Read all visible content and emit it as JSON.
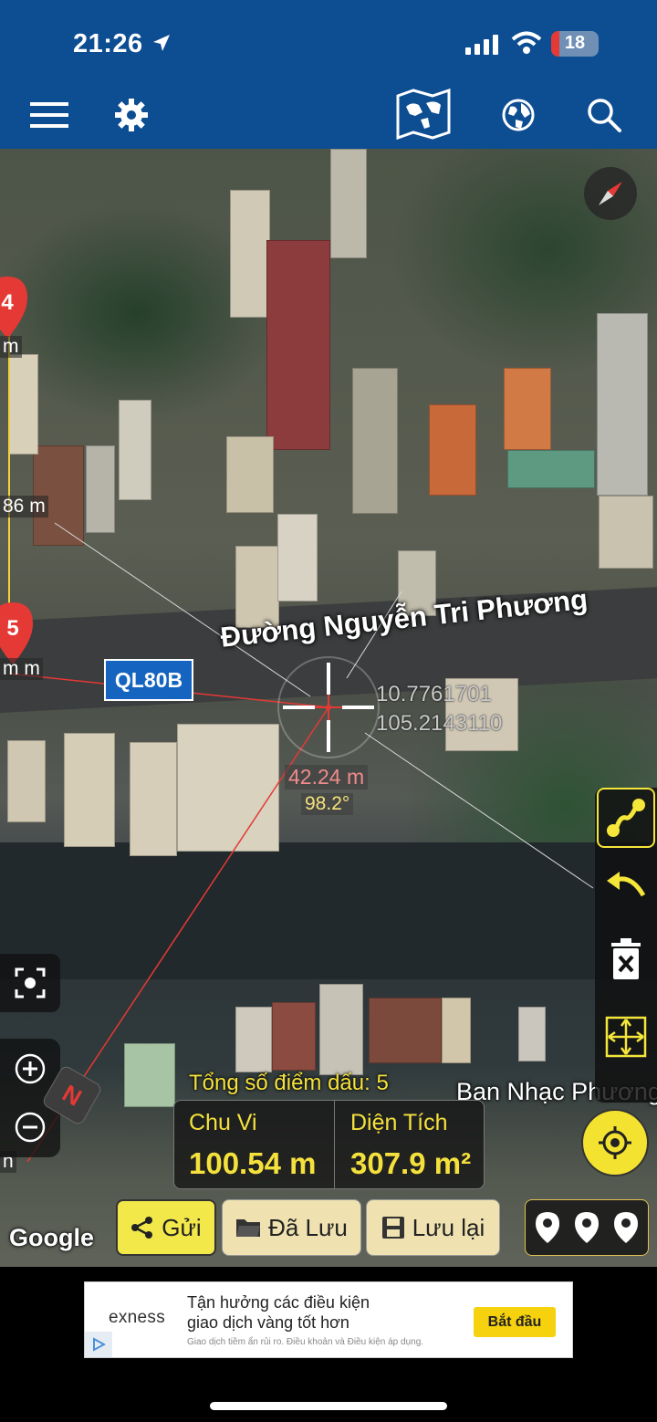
{
  "status_bar": {
    "time": "21:26",
    "battery": "18",
    "battery_level": 0.18
  },
  "top_bar": {
    "icons": [
      "menu-icon",
      "settings-icon",
      "map-type-icon",
      "globe-icon",
      "search-icon"
    ]
  },
  "map": {
    "street_name": "Đường Nguyễn Tri Phương",
    "route_shield": "QL80B",
    "coordinates": {
      "latitude": "10.7761701",
      "longitude": "105.2143110"
    },
    "measurement": {
      "distance": "42.24 m",
      "bearing": "98.2°"
    },
    "markers": [
      {
        "label": "4"
      },
      {
        "label": "5"
      }
    ],
    "edge_labels": [
      "m",
      "86 m",
      "m m",
      "n"
    ],
    "poi_label": "Ban Nhạc Phương",
    "attribution": "Google",
    "colors": {
      "marker": "#e53935",
      "measure_line": "#e53935",
      "accent_yellow": "#f5e13c"
    }
  },
  "controls": {
    "compass_icon": "compass-icon",
    "right_tools": [
      "route-icon",
      "undo-icon",
      "delete-icon",
      "fit-extent-icon"
    ],
    "left_tools": [
      "focus-icon",
      "zoom-in-icon",
      "zoom-out-icon"
    ],
    "north_label": "N",
    "locate_icon": "crosshair-gps-icon"
  },
  "summary": {
    "marker_count_label": "Tổng số điểm dấu: 5",
    "perimeter_label": "Chu Vi",
    "perimeter_value": "100.54 m",
    "area_label": "Diện Tích",
    "area_value": "307.9 m²"
  },
  "actions": {
    "send": "Gửi",
    "saved": "Đã Lưu",
    "save": "Lưu lại"
  },
  "ad": {
    "brand": "exness",
    "line1": "Tận hưởng các điều kiện",
    "line2": "giao dịch vàng tốt hơn",
    "disclaimer": "Giao dịch tiềm ẩn rủi ro. Điều khoản và Điều kiện áp dụng.",
    "cta": "Bắt đầu"
  }
}
